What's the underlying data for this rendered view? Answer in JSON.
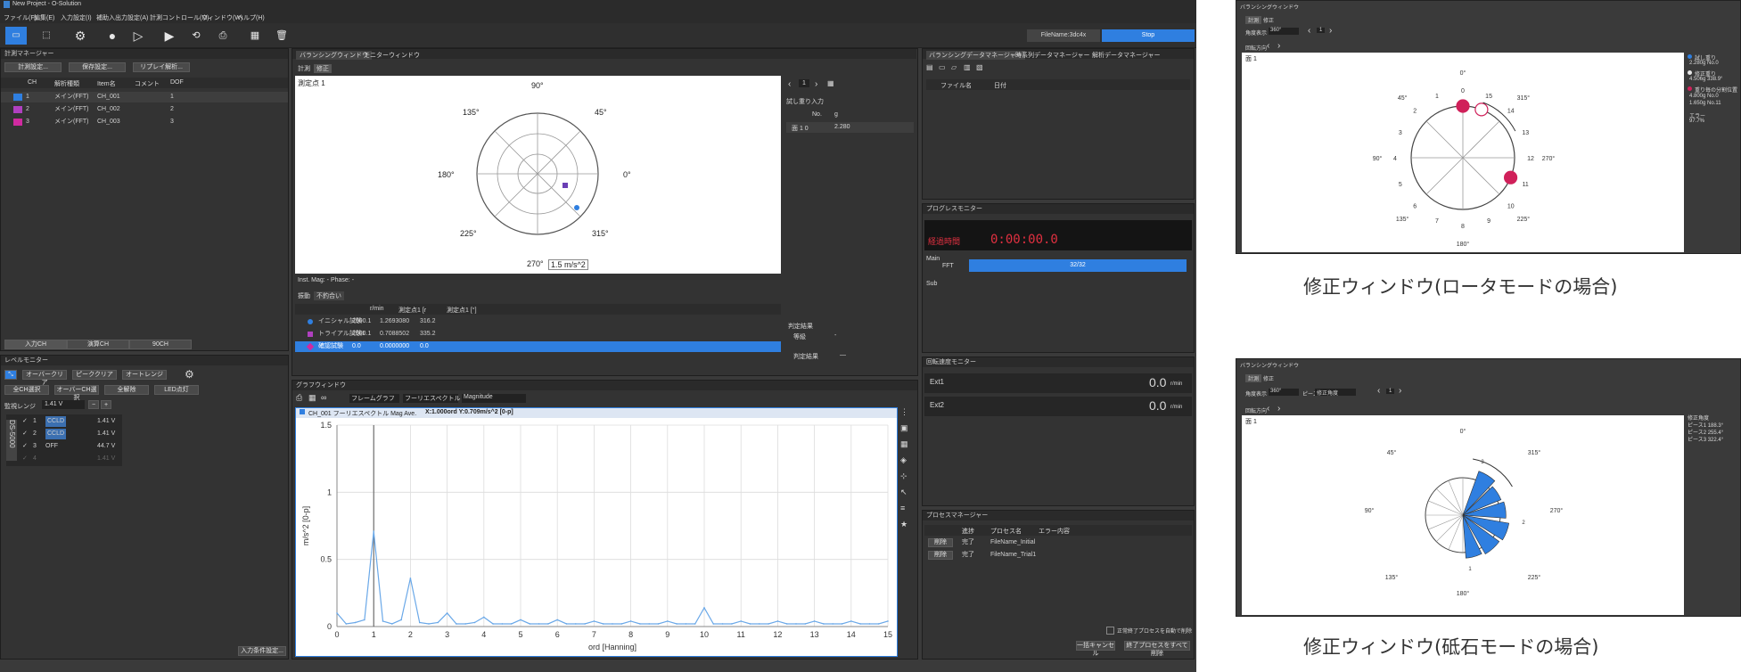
{
  "app": {
    "title": "New Project - O-Solution",
    "menu": [
      "ファイル(F)",
      "編集(E)",
      "入力設定(I)",
      "補助入出力設定(A)",
      "計測コントロール(M)",
      "ウィンドウ(W)",
      "ヘルプ(H)"
    ],
    "filename_label": "FileName:3dc4x",
    "stop_label": "Stop"
  },
  "measure_manager": {
    "title": "計測マネージャー",
    "buttons": [
      "計測設定...",
      "保存設定...",
      "リプレイ解析..."
    ],
    "columns": [
      "CH",
      "解析種類",
      "Item名",
      "コメント",
      "DOF"
    ],
    "rows": [
      {
        "ch": "1",
        "type": "メイン(FFT)",
        "item": "CH_001",
        "dof": "1",
        "color": "#2f7fe0"
      },
      {
        "ch": "2",
        "type": "メイン(FFT)",
        "item": "CH_002",
        "dof": "2",
        "color": "#b040c0"
      },
      {
        "ch": "3",
        "type": "メイン(FFT)",
        "item": "CH_003",
        "dof": "3",
        "color": "#d02aa0"
      }
    ],
    "tabs": [
      "入力CH",
      "演算CH",
      "90CH"
    ]
  },
  "level_monitor": {
    "title": "レベルモニター",
    "buttons": [
      "オーバークリア",
      "ピーククリア",
      "オートレンジ"
    ],
    "buttons2": [
      "全CH選択",
      "オーバーCH選択",
      "全解除",
      "LED点灯"
    ],
    "range_label": "監視レンジ",
    "range_value": "1.41 V",
    "device": "DS-5000",
    "channels": [
      {
        "n": "1",
        "mode": "CCLD",
        "value": "1.41 V"
      },
      {
        "n": "2",
        "mode": "CCLD",
        "value": "1.41 V"
      },
      {
        "n": "3",
        "mode": "OFF",
        "value": "44.7 V"
      },
      {
        "n": "4",
        "mode": "",
        "value": "1.41 V"
      }
    ],
    "input_settings_btn": "入力条件設定..."
  },
  "balancing_window": {
    "tabs": [
      "バランシングウィンドウ",
      "モニターウィンドウ"
    ],
    "subtabs": [
      "計測",
      "修正"
    ],
    "point_label": "測定点 1",
    "angles": [
      "90°",
      "45°",
      "0°",
      "315°",
      "270°",
      "225°",
      "180°",
      "135°"
    ],
    "scale_label": "1.5 m/s^2",
    "page": "1",
    "inst_readout": "Inst.  Mag: -  Phase: -",
    "trial_input_label": "試し重り入力",
    "trial_cols": [
      "No.",
      "g"
    ],
    "trial_row": {
      "name": "面 1 0",
      "g": "2.280"
    },
    "bottom_tabs": [
      "振動",
      "不釣合い"
    ],
    "table_cols": [
      "",
      "r/min",
      "測定点1 [r",
      "測定点1 [°]"
    ],
    "table_rows": [
      {
        "name": "イニシャル試験",
        "rpm": "2000.1",
        "mag": "1.2693080",
        "phase": "316.2",
        "color": "#2f7fe0"
      },
      {
        "name": "トライアル試験1",
        "rpm": "2000.1",
        "mag": "0.7088502",
        "phase": "335.2",
        "color": "#b040c0"
      },
      {
        "name": "確認試験",
        "rpm": "0.0",
        "mag": "0.0000000",
        "phase": "0.0",
        "color": "#d02aa0"
      }
    ],
    "judge_title": "判定結果",
    "judge_label": "等級",
    "judge_value": "-",
    "judge_result_label": "判定結果",
    "judge_result_value": "—"
  },
  "graph_window": {
    "title": "グラフウィンドウ",
    "dropdowns": [
      "フレームグラフ",
      "フーリエスペクトル",
      "Magnitude"
    ],
    "trace_label": "CH_001  フーリエスペクトル Mag Ave.",
    "cursor_readout": "X:1.000ord  Y:0.709m/s^2 [0-p]"
  },
  "chart_data": {
    "type": "line",
    "xlabel": "ord [Hanning]",
    "ylabel": "m/s^2 [0-p]",
    "xlim": [
      0,
      15
    ],
    "ylim": [
      0,
      1.5
    ],
    "xticks": [
      "0",
      "1",
      "2",
      "3",
      "4",
      "5",
      "6",
      "7",
      "8",
      "9",
      "10",
      "11",
      "12",
      "13",
      "14",
      "15"
    ],
    "yticks": [
      "0",
      "0.5",
      "1",
      "1.5"
    ],
    "series": [
      {
        "x": [
          0,
          0.25,
          0.5,
          0.75,
          1,
          1.25,
          1.5,
          1.75,
          2,
          2.25,
          2.5,
          2.75,
          3,
          3.25,
          3.5,
          3.75,
          4,
          4.25,
          4.5,
          4.75,
          5,
          5.25,
          5.5,
          5.75,
          6,
          6.25,
          6.5,
          6.75,
          7,
          7.25,
          7.5,
          7.75,
          8,
          8.25,
          8.5,
          8.75,
          9,
          9.25,
          9.5,
          9.75,
          10,
          10.25,
          10.5,
          10.75,
          11,
          11.25,
          11.5,
          11.75,
          12,
          12.25,
          12.5,
          12.75,
          13,
          13.25,
          13.5,
          13.75,
          14,
          14.25,
          14.5,
          14.75,
          15
        ],
        "y": [
          0.1,
          0.02,
          0.03,
          0.05,
          0.71,
          0.04,
          0.02,
          0.05,
          0.36,
          0.03,
          0.02,
          0.03,
          0.1,
          0.02,
          0.02,
          0.03,
          0.07,
          0.02,
          0.02,
          0.02,
          0.05,
          0.02,
          0.02,
          0.02,
          0.05,
          0.02,
          0.02,
          0.02,
          0.04,
          0.02,
          0.02,
          0.02,
          0.04,
          0.02,
          0.02,
          0.02,
          0.04,
          0.02,
          0.02,
          0.02,
          0.14,
          0.02,
          0.02,
          0.02,
          0.04,
          0.02,
          0.02,
          0.02,
          0.04,
          0.02,
          0.02,
          0.02,
          0.04,
          0.02,
          0.02,
          0.02,
          0.04,
          0.02,
          0.02,
          0.02,
          0.04
        ],
        "color": "#6aa8e8"
      }
    ]
  },
  "right_panels": {
    "tabs": [
      "バランシングデータマネージャー",
      "時系列データマネージャー",
      "解析データマネージャー"
    ],
    "file_cols": [
      "ファイル名",
      "日付"
    ],
    "progress_title": "プログレスモニター",
    "elapsed_label": "経過時間",
    "elapsed_value": "0:00:00.0",
    "main_label": "Main",
    "fft_label": "FFT",
    "progress_text": "32/32",
    "progress_fraction": 1.0,
    "sub_label": "Sub",
    "rotation_title": "回転速度モニター",
    "ext1_label": "Ext1",
    "ext1_value": "0.0",
    "ext2_label": "Ext2",
    "ext2_value": "0.0",
    "rpm_unit": "r/min",
    "process_title": "プロセスマネージャー",
    "process_cols": [
      "進捗",
      "プロセス名",
      "エラー内容"
    ],
    "processes": [
      {
        "btn": "削除",
        "status": "完了",
        "name": "FileName_Initial"
      },
      {
        "btn": "削除",
        "status": "完了",
        "name": "FileName_Trial1"
      }
    ],
    "auto_delete_label": "正常終了プロセスを自動で削除",
    "cancel_all": "一括キャンセル",
    "delete_done": "終了プロセスをすべて削除"
  },
  "rotor_window": {
    "title": "バランシングウィンドウ",
    "tabs": [
      "計測",
      "修正"
    ],
    "angle_label": "角度表示",
    "angle_value": "360°",
    "page": "1",
    "direction_label": "回転方向",
    "face_label": "面 1",
    "outer_angles": [
      "0°",
      "45°",
      "315°",
      "90°",
      "270°",
      "135°",
      "225°",
      "180°"
    ],
    "positions": [
      "0",
      "1",
      "2",
      "3",
      "4",
      "5",
      "6",
      "7",
      "8",
      "9",
      "10",
      "11",
      "12",
      "13",
      "14",
      "15"
    ],
    "legend": [
      {
        "label": "試し重り",
        "value": "2.280g No.0",
        "color": "#2f7fe0"
      },
      {
        "label": "修正重り",
        "value": "4.506g 338.9°",
        "color": "#e8e8e8"
      },
      {
        "label": "重り毎の分割位置",
        "value": "4.800g No.0\n1.650g No.11",
        "color": "#d0205a"
      }
    ],
    "error_label": "エラー",
    "error_value": "97.7%",
    "caption": "修正ウィンドウ(ロータモードの場合)"
  },
  "grind_window": {
    "title": "バランシングウィンドウ",
    "tabs": [
      "計測",
      "修正"
    ],
    "angle_label": "角度表示",
    "angle_value": "360°",
    "piece_label": "ピース",
    "piece_value": "修正角度",
    "page": "1",
    "direction_label": "回転方向",
    "face_label": "面 1",
    "outer_angles": [
      "0°",
      "45°",
      "315°",
      "90°",
      "270°",
      "135°",
      "225°",
      "180°"
    ],
    "inner_labels": [
      "3",
      "2",
      "1"
    ],
    "info": [
      "修正角度",
      "ピース1  188.3°",
      "ピース2  255.4°",
      "ピース3  322.4°"
    ],
    "caption": "修正ウィンドウ(砥石モードの場合)"
  }
}
